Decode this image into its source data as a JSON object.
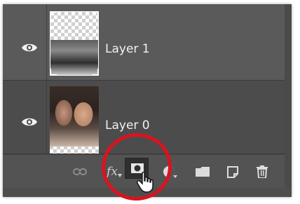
{
  "layers": [
    {
      "name": "Layer 1",
      "visible": true,
      "selected": true,
      "thumbnail": "transparent-checkerboard-with-bw-photo"
    },
    {
      "name": "Layer 0",
      "visible": true,
      "selected": false,
      "thumbnail": "couple-photo"
    }
  ],
  "toolbar": {
    "icons": [
      "link-layers-icon",
      "fx-icon",
      "add-layer-mask-icon",
      "adjustment-layer-icon",
      "folder-icon",
      "new-layer-icon",
      "trash-icon"
    ],
    "fx_label": "fx"
  },
  "highlight": {
    "target": "add-layer-mask-button",
    "color": "#d8141f"
  },
  "colors": {
    "panel": "#535353",
    "row_selected": "#5a5a5a",
    "row": "#4c4c4c",
    "text": "#f0f0f0"
  }
}
